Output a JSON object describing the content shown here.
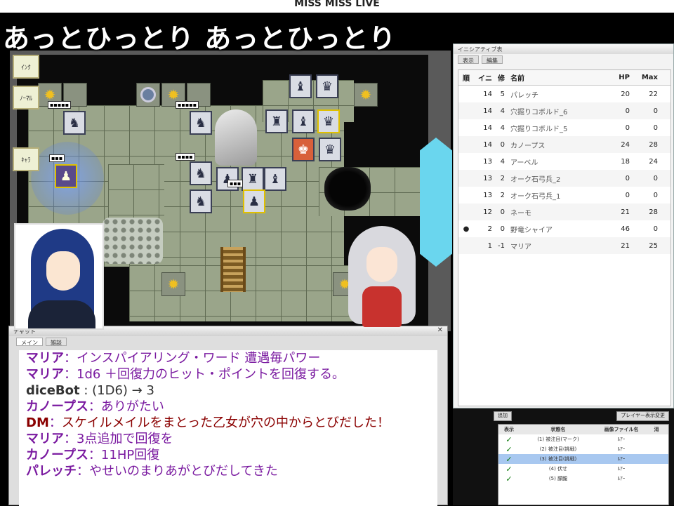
{
  "stream": {
    "top_banner": "MISS MISS LIVE",
    "caption": "あっとひっとり あっとひっとり"
  },
  "map": {
    "side_buttons": [
      "ｲﾝｸ",
      "ﾉｰﾏﾙ",
      "ｷｬﾗ"
    ]
  },
  "initiative": {
    "window_title": "イニシアティブ表",
    "tabs": [
      "表示",
      "編集"
    ],
    "headers": {
      "mark": "順",
      "init": "イニ",
      "mod": "修",
      "name": "名前",
      "hp": "HP",
      "max": "Max"
    },
    "rows": [
      {
        "mark": "",
        "init": "14",
        "mod": "5",
        "name": "パレッチ",
        "hp": "20",
        "max": "22"
      },
      {
        "mark": "",
        "init": "14",
        "mod": "4",
        "name": "穴掘りコボルド_6",
        "hp": "0",
        "max": "0"
      },
      {
        "mark": "",
        "init": "14",
        "mod": "4",
        "name": "穴掘りコボルド_5",
        "hp": "0",
        "max": "0"
      },
      {
        "mark": "",
        "init": "14",
        "mod": "0",
        "name": "カノープス",
        "hp": "24",
        "max": "28"
      },
      {
        "mark": "",
        "init": "13",
        "mod": "4",
        "name": "アーベル",
        "hp": "18",
        "max": "24"
      },
      {
        "mark": "",
        "init": "13",
        "mod": "2",
        "name": "オーク石弓兵_2",
        "hp": "0",
        "max": "0"
      },
      {
        "mark": "",
        "init": "13",
        "mod": "2",
        "name": "オーク石弓兵_1",
        "hp": "0",
        "max": "0"
      },
      {
        "mark": "",
        "init": "12",
        "mod": "0",
        "name": "ネーモ",
        "hp": "21",
        "max": "28"
      },
      {
        "mark": "●",
        "init": "2",
        "mod": "0",
        "name": "野竜シャイア",
        "hp": "46",
        "max": "0"
      },
      {
        "mark": "",
        "init": "1",
        "mod": "-1",
        "name": "マリア",
        "hp": "21",
        "max": "25"
      }
    ]
  },
  "status_panel": {
    "buttons": [
      "追加",
      "プレイヤー表示変更"
    ],
    "headers": [
      "表示",
      "状態名",
      "画像ファイル名",
      "消"
    ],
    "rows": [
      {
        "check": "✓",
        "name": "(1) 被注目(マーク)",
        "value": "ﾙｱｰ"
      },
      {
        "check": "✓",
        "name": "(2) 被注目(挑戦)",
        "value": "ﾙｱｰ"
      },
      {
        "check": "✓",
        "name": "(3) 被注目(挑戦)",
        "value": "ﾙｱｰ"
      },
      {
        "check": "✓",
        "name": "(4) 伏せ",
        "value": "ﾙｱｰ"
      },
      {
        "check": "✓",
        "name": "(5) 朦朧",
        "value": "ﾙｱｰ"
      }
    ]
  },
  "chat": {
    "window_title": "チャット",
    "tabs": [
      "メイン",
      "雑談"
    ],
    "lines": [
      {
        "speaker": "マリア",
        "text": "インスパイアリング・ワード 遭遇毎パワー",
        "kind": "player"
      },
      {
        "speaker": "マリア",
        "text": "1d6 ＋回復力のヒット・ポイントを回復する。",
        "kind": "player"
      },
      {
        "speaker": "diceBot",
        "text": "(1D6) → 3",
        "kind": "system"
      },
      {
        "speaker": "カノープス",
        "text": "ありがたい",
        "kind": "player"
      },
      {
        "speaker": "DM",
        "text": "スケイルメイルをまとった乙女が穴の中からとびだした！",
        "kind": "dm"
      },
      {
        "speaker": "マリア",
        "text": "3点追加で回復を",
        "kind": "player"
      },
      {
        "speaker": "カノープス",
        "text": "11HP回復",
        "kind": "player"
      },
      {
        "speaker": "パレッチ",
        "text": "やせいのまりあがとびだしてきた",
        "kind": "player"
      }
    ]
  }
}
